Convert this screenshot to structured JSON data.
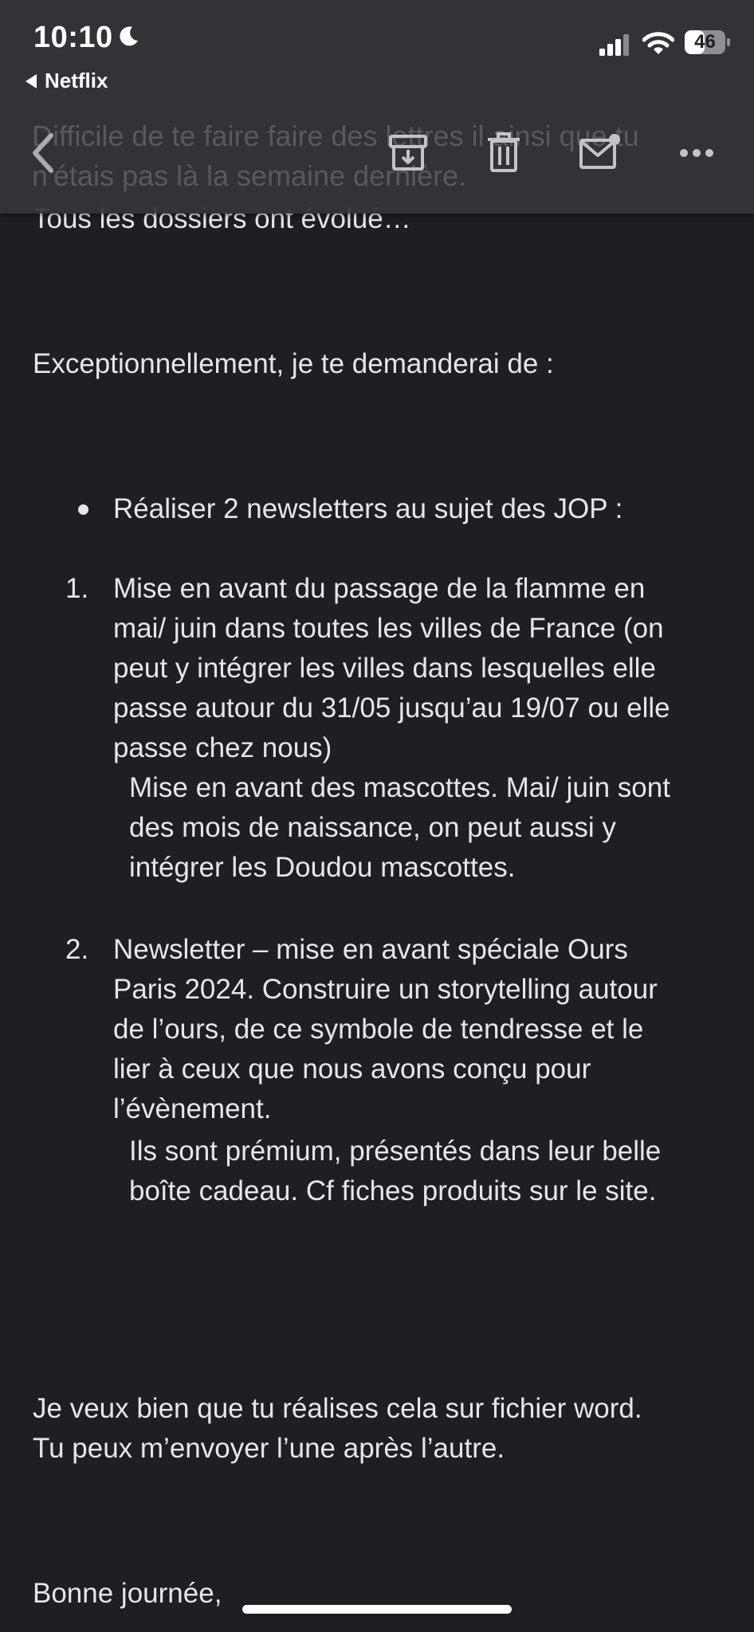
{
  "status_bar": {
    "time": "10:10",
    "back_app": "Netflix",
    "battery": "46"
  },
  "header": {
    "behind_line_1": "Difficile de te faire faire des lettres il ainsi que tu",
    "behind_line_2": "n'étais pas là la semaine dernière.",
    "icons": [
      "back-chevron-icon",
      "archive-icon",
      "trash-icon",
      "mail-unread-icon",
      "more-icon"
    ]
  },
  "email": {
    "partial_line": "Tous les dossiers ont évolué…",
    "intro": "Exceptionnellement, je te demanderai de :",
    "bullet": "Réaliser 2 newsletters au sujet des JOP :",
    "items": [
      {
        "number": "1.",
        "lines": [
          "Mise en avant du passage de la flamme en",
          "mai/ juin dans toutes les villes de France (on",
          "peut y intégrer les villes dans lesquelles elle",
          "passe autour du 31/05 jusqu’au 19/07 ou elle",
          "passe chez nous)"
        ],
        "sub_lines": [
          "Mise en avant des mascottes. Mai/ juin sont",
          "des mois de naissance, on peut aussi y",
          "intégrer les Doudou mascottes."
        ]
      },
      {
        "number": "2.",
        "lines": [
          "Newsletter – mise en avant spéciale Ours",
          "Paris 2024. Construire un storytelling autour",
          "de l’ours, de ce symbole de tendresse et le",
          "lier à ceux que nous avons conçu pour",
          "l’évènement."
        ],
        "sub_lines": [
          "Ils sont prémium, présentés dans leur belle",
          "boîte cadeau. Cf fiches produits sur le site."
        ]
      }
    ],
    "closing_1": "Je veux bien que tu réalises cela sur fichier word.",
    "closing_2": "Tu peux m’envoyer l’une après l’autre.",
    "sign_off": "Bonne journée,"
  },
  "colors": {
    "background": "#1e1f23",
    "header": "#343539",
    "text": "#e6e6e8"
  }
}
